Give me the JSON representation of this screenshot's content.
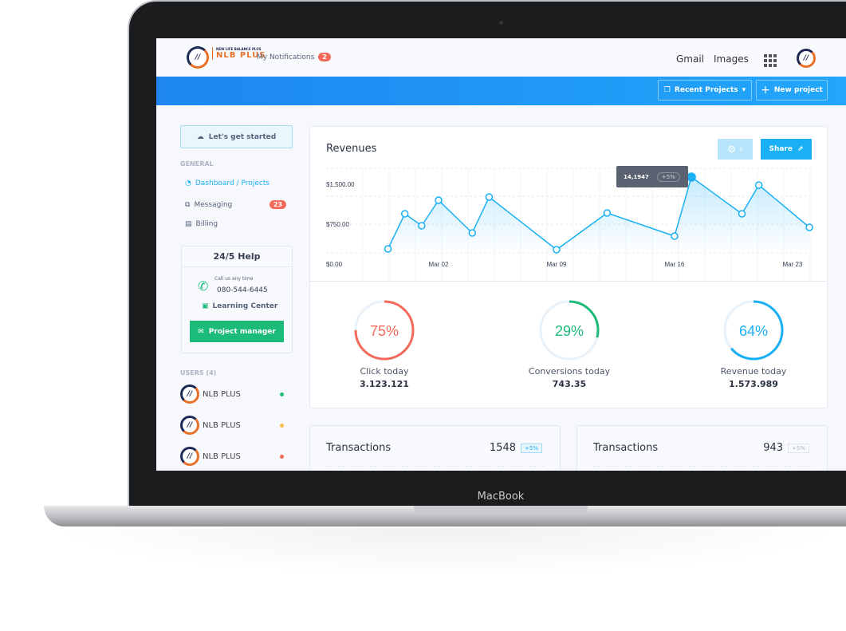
{
  "device_label": "MacBook",
  "header": {
    "brand_top": "NEW LIFE BALANCE PLUS",
    "brand": "NLB PLUS",
    "notifications_label": "My Notifications",
    "notifications_count": "2",
    "gmail": "Gmail",
    "images": "Images"
  },
  "toolbar": {
    "recent_projects": "Recent Projects",
    "new_project": "New project"
  },
  "sidebar": {
    "get_started": "Let's get started",
    "section_general": "GENERAL",
    "items": [
      {
        "label": "Dashboard / Projects",
        "active": true
      },
      {
        "label": "Messaging",
        "badge": "23"
      },
      {
        "label": "Billing"
      }
    ],
    "help": {
      "title": "24/5 Help",
      "call_label": "Call us any time",
      "phone": "080-544-6445",
      "learning": "Learning Center",
      "button": "Project manager"
    },
    "users_label": "USERS (4)",
    "users": [
      {
        "name": "NLB PLUS",
        "status_color": "#1dbb7a"
      },
      {
        "name": "NLB PLUS",
        "status_color": "#fbb94a"
      },
      {
        "name": "NLB PLUS",
        "status_color": "#f46a5a"
      }
    ]
  },
  "revenues": {
    "title": "Revenues",
    "share": "Share",
    "tooltip_value": "14,1947",
    "tooltip_change": "+5%"
  },
  "chart_data": {
    "type": "line",
    "title": "Revenues",
    "yticks": [
      "$0.00",
      "$750.00",
      "$1,500.00"
    ],
    "ytick_values": [
      0,
      750,
      1500
    ],
    "xticks": [
      "Mar 02",
      "Mar 09",
      "Mar 16",
      "Mar 23"
    ],
    "x": [
      "Feb 27",
      "Feb 28",
      "Mar 01",
      "Mar 02",
      "Mar 04",
      "Mar 05",
      "Mar 09",
      "Mar 12",
      "Mar 16",
      "Mar 17",
      "Mar 20",
      "Mar 21",
      "Mar 24"
    ],
    "values": [
      285,
      945,
      720,
      1200,
      585,
      1260,
      270,
      960,
      525,
      1635,
      945,
      1485,
      690
    ],
    "highlight_index": 9,
    "color": "#1ab0f5",
    "grid": true
  },
  "stats": [
    {
      "percent": 75,
      "label": "Click today",
      "value": "3.123.121",
      "color": "#f46a5a"
    },
    {
      "percent": 29,
      "label": "Conversions today",
      "value": "743.35",
      "color": "#1dbb7a"
    },
    {
      "percent": 64,
      "label": "Revenue today",
      "value": "1.573.989",
      "color": "#1ab0f5"
    }
  ],
  "transactions": [
    {
      "title": "Transactions",
      "value": "1548",
      "change": "+5%"
    },
    {
      "title": "Transactions",
      "value": "943",
      "change": "+5%"
    }
  ]
}
